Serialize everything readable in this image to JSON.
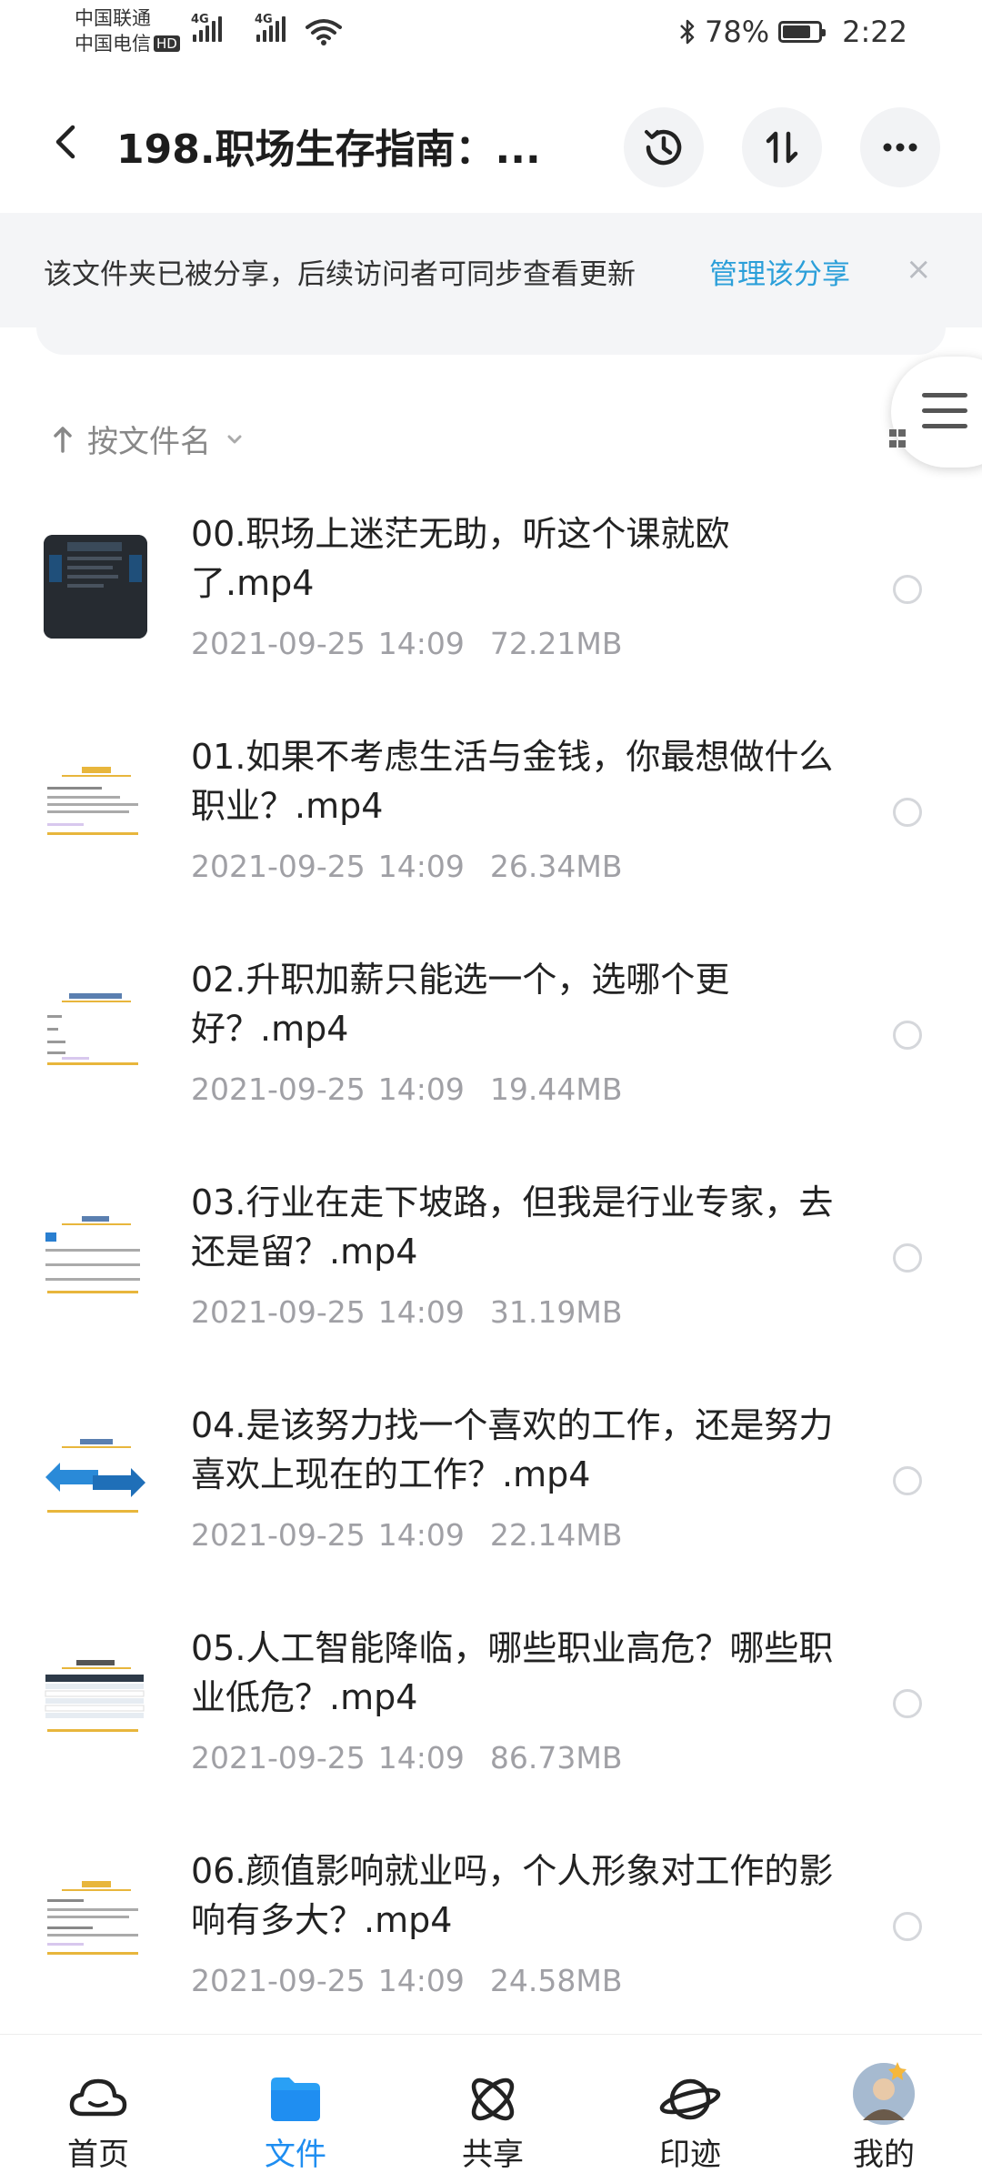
{
  "status_bar": {
    "carrier1": "中国联通",
    "carrier2": "中国电信",
    "hd": "HD",
    "net1": "4G",
    "net2": "4G",
    "battery_text": "78%",
    "battery_level": 0.78,
    "time": "2:22"
  },
  "header": {
    "title": "198.职场生存指南：..."
  },
  "banner": {
    "text": "该文件夹已被分享，后续访问者可同步查看更新",
    "link": "管理该分享",
    "close": "×"
  },
  "sort": {
    "label": "按文件名"
  },
  "files": [
    {
      "name": "00.职场上迷茫无助，听这个课就欧了.mp4",
      "date": "2021-09-25",
      "time": "14:09",
      "size": "72.21MB"
    },
    {
      "name": "01.如果不考虑生活与金钱，你最想做什么职业？.mp4",
      "date": "2021-09-25",
      "time": "14:09",
      "size": "26.34MB"
    },
    {
      "name": "02.升职加薪只能选一个，选哪个更好？.mp4",
      "date": "2021-09-25",
      "time": "14:09",
      "size": "19.44MB"
    },
    {
      "name": "03.行业在走下坡路，但我是行业专家，去还是留？.mp4",
      "date": "2021-09-25",
      "time": "14:09",
      "size": "31.19MB"
    },
    {
      "name": "04.是该努力找一个喜欢的工作，还是努力喜欢上现在的工作？.mp4",
      "date": "2021-09-25",
      "time": "14:09",
      "size": "22.14MB"
    },
    {
      "name": "05.人工智能降临，哪些职业高危？哪些职业低危？.mp4",
      "date": "2021-09-25",
      "time": "14:09",
      "size": "86.73MB"
    },
    {
      "name": "06.颜值影响就业吗，个人形象对工作的影响有多大？.mp4",
      "date": "2021-09-25",
      "time": "14:09",
      "size": "24.58MB"
    }
  ],
  "nav": {
    "home": "首页",
    "files": "文件",
    "share": "共享",
    "moments": "印迹",
    "me": "我的"
  },
  "colors": {
    "accent": "#1f8ef1",
    "link": "#2b9fd9",
    "meta": "#a0a0a5"
  }
}
